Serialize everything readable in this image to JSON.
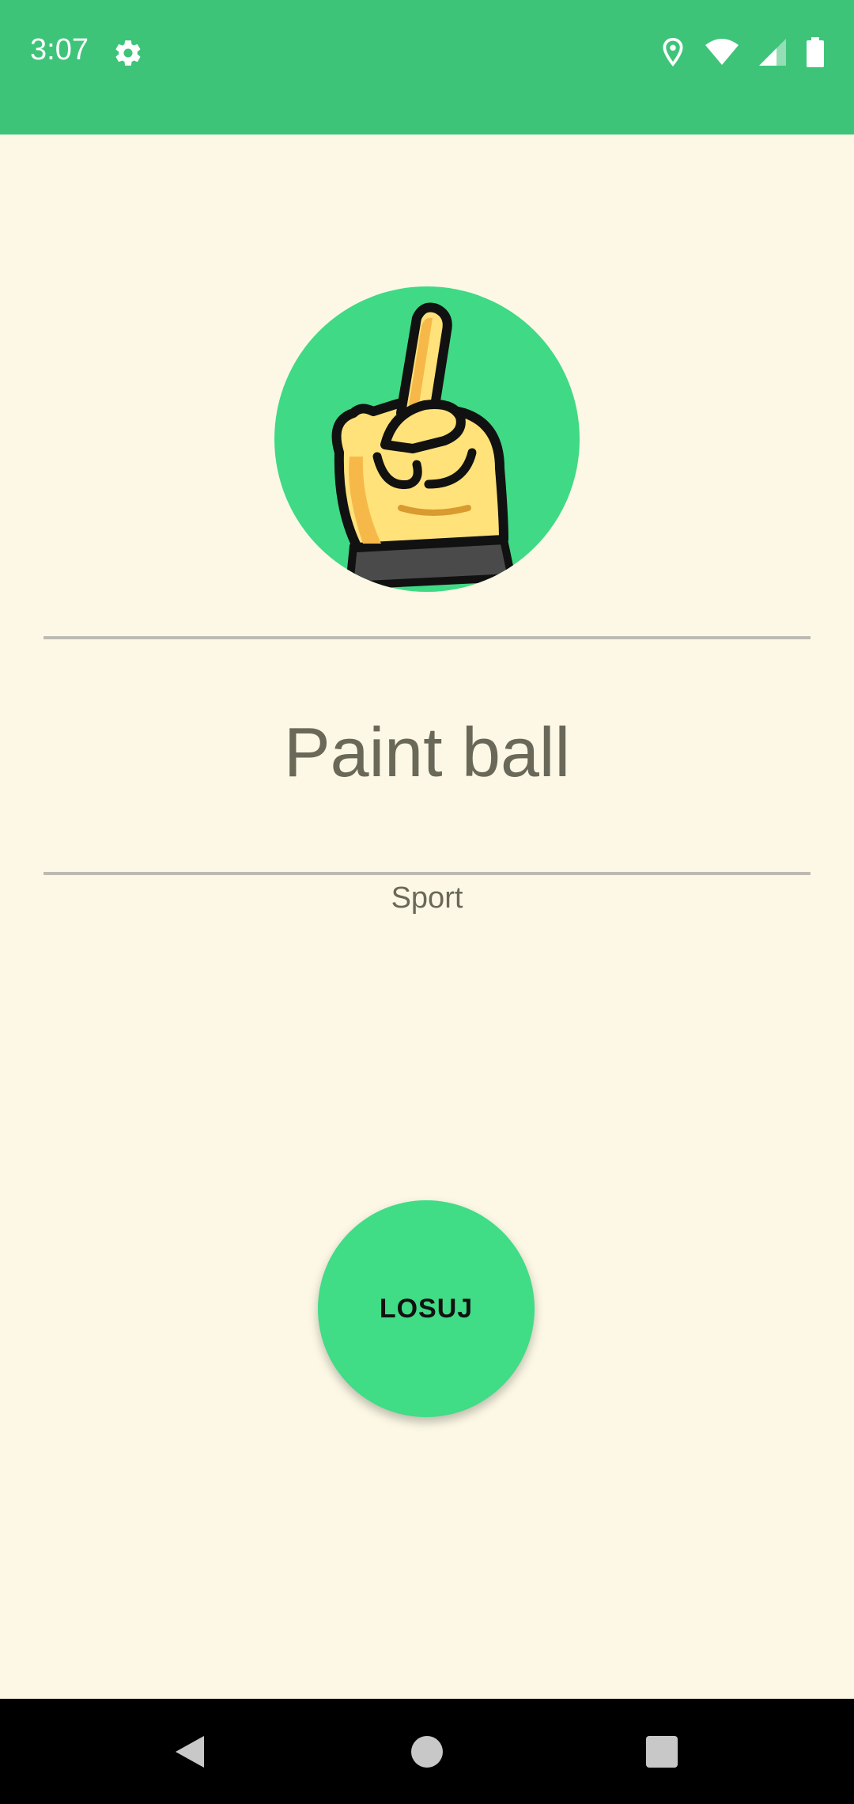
{
  "status_bar": {
    "time": "3:07",
    "icons": [
      "settings-icon",
      "location-icon",
      "wifi-icon",
      "signal-icon",
      "battery-icon"
    ]
  },
  "main": {
    "hero_icon": "hand-fingers-crossed-icon",
    "title": "Paint ball",
    "category": "Sport",
    "draw_button_label": "LOSUJ"
  },
  "nav_bar": {
    "buttons": [
      "back-icon",
      "home-icon",
      "recents-icon"
    ]
  },
  "colors": {
    "status_bar": "#3ec479",
    "background": "#fcf8e5",
    "accent_green": "#40d985",
    "text": "#6a6858",
    "divider": "#bdbab2"
  }
}
